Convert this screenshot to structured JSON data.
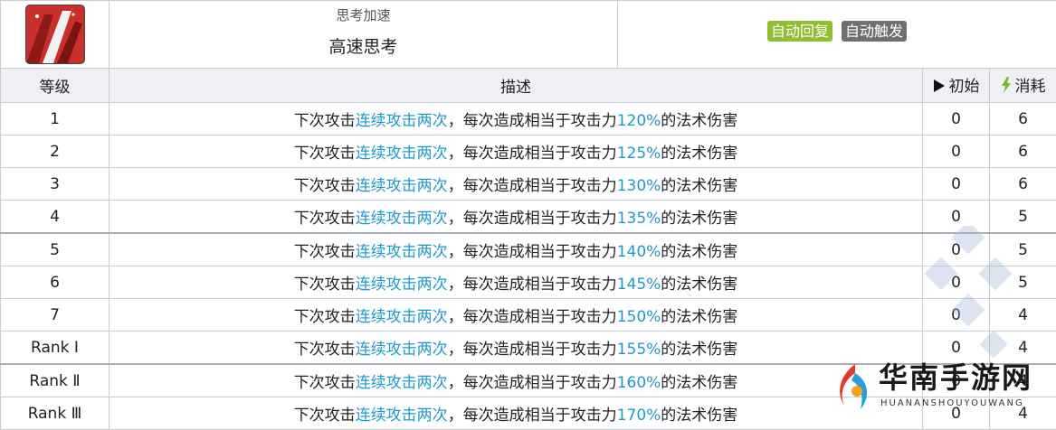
{
  "skill": {
    "icon": "red-slash-icon",
    "subtitle": "思考加速",
    "name": "高速思考",
    "tags": [
      "自动回复",
      "自动触发"
    ]
  },
  "headers": {
    "level": "等级",
    "desc": "描述",
    "initial": "初始",
    "cost": "消耗"
  },
  "rows": [
    {
      "level": "1",
      "pre": "下次攻击",
      "hl": "连续攻击两次",
      "mid": "，每次造成相当于攻击力",
      "pct": "120%",
      "post": "的法术伤害",
      "initial": "0",
      "cost": "6"
    },
    {
      "level": "2",
      "pre": "下次攻击",
      "hl": "连续攻击两次",
      "mid": "，每次造成相当于攻击力",
      "pct": "125%",
      "post": "的法术伤害",
      "initial": "0",
      "cost": "6"
    },
    {
      "level": "3",
      "pre": "下次攻击",
      "hl": "连续攻击两次",
      "mid": "，每次造成相当于攻击力",
      "pct": "130%",
      "post": "的法术伤害",
      "initial": "0",
      "cost": "6"
    },
    {
      "level": "4",
      "pre": "下次攻击",
      "hl": "连续攻击两次",
      "mid": "，每次造成相当于攻击力",
      "pct": "135%",
      "post": "的法术伤害",
      "initial": "0",
      "cost": "5"
    },
    {
      "level": "5",
      "pre": "下次攻击",
      "hl": "连续攻击两次",
      "mid": "，每次造成相当于攻击力",
      "pct": "140%",
      "post": "的法术伤害",
      "initial": "0",
      "cost": "5"
    },
    {
      "level": "6",
      "pre": "下次攻击",
      "hl": "连续攻击两次",
      "mid": "，每次造成相当于攻击力",
      "pct": "145%",
      "post": "的法术伤害",
      "initial": "0",
      "cost": "5"
    },
    {
      "level": "7",
      "pre": "下次攻击",
      "hl": "连续攻击两次",
      "mid": "，每次造成相当于攻击力",
      "pct": "150%",
      "post": "的法术伤害",
      "initial": "0",
      "cost": "4"
    },
    {
      "level": "Rank Ⅰ",
      "pre": "下次攻击",
      "hl": "连续攻击两次",
      "mid": "，每次造成相当于攻击力",
      "pct": "155%",
      "post": "的法术伤害",
      "initial": "0",
      "cost": "4"
    },
    {
      "level": "Rank Ⅱ",
      "pre": "下次攻击",
      "hl": "连续攻击两次",
      "mid": "，每次造成相当于攻击力",
      "pct": "160%",
      "post": "的法术伤害",
      "initial": "0",
      "cost": "4"
    },
    {
      "level": "Rank Ⅲ",
      "pre": "下次攻击",
      "hl": "连续攻击两次",
      "mid": "，每次造成相当于攻击力",
      "pct": "170%",
      "post": "的法术伤害",
      "initial": "0",
      "cost": "4"
    }
  ],
  "watermark": {
    "name": "华南手游网",
    "url_text": "HUANANSHOUYOUWANG"
  },
  "colors": {
    "highlight": "#1f9ac8",
    "tag_green": "#8dbf2e",
    "tag_gray": "#707070",
    "header_bg": "#eef0f4"
  }
}
